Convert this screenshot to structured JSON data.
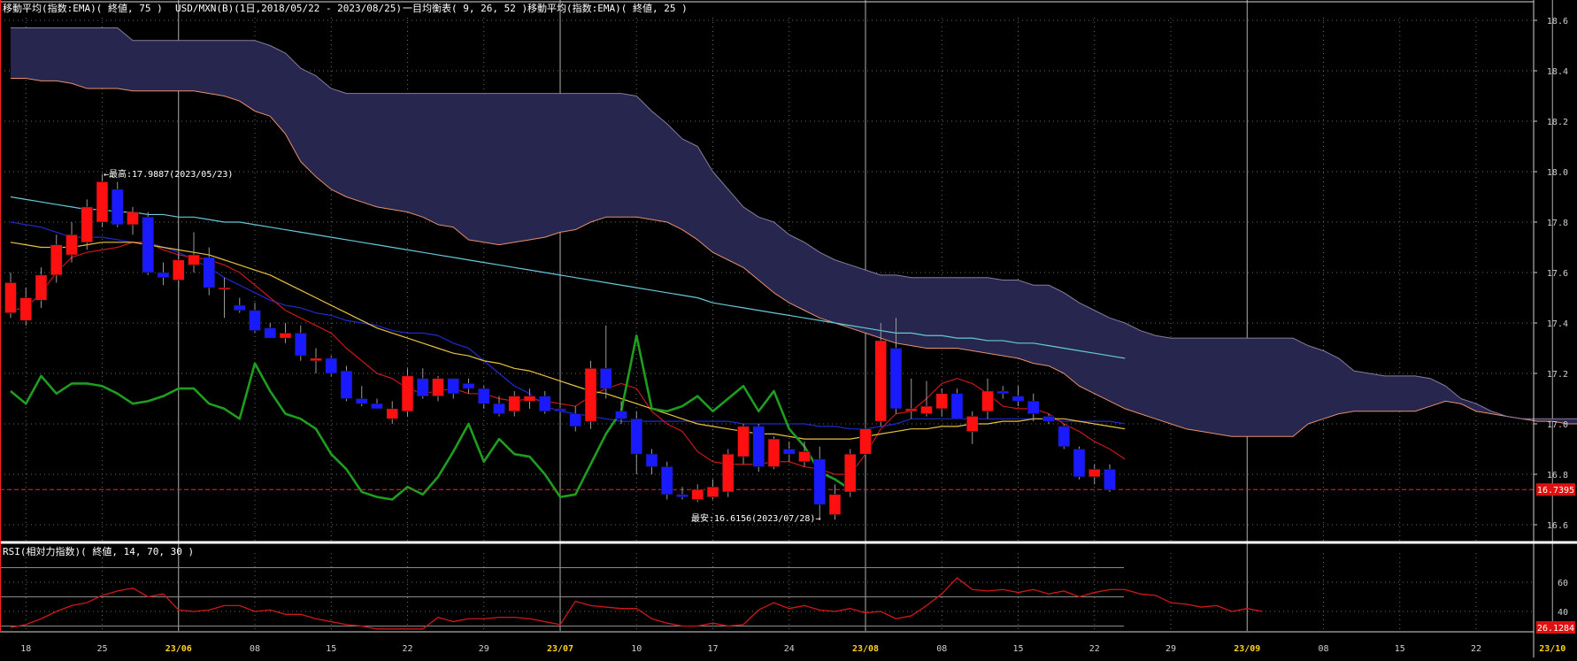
{
  "header": {
    "ema75": "移動平均(指数:EMA)( 終値, 75 )",
    "symbol": "USD/MXN(B)(1日,2018/05/22 - 2023/08/25)",
    "ichimoku": "一目均衡表( 9, 26, 52 )",
    "ema25": "移動平均(指数:EMA)( 終値, 25 )"
  },
  "rsi_header": "RSI(相対力指数)( 終値, 14, 70, 30 )",
  "annotations": {
    "high": "←最高:17.9887(2023/05/23)",
    "low": "最安:16.6156(2023/07/28)→"
  },
  "colors": {
    "up": "#ff1010",
    "down": "#1a1aff",
    "cloud": "#26264e",
    "cloud_edge": "#e6906a",
    "ema75": "#66c8d8",
    "ema25": "#e8c040",
    "tenkan": "#c81818",
    "kijun": "#1e2ad0",
    "chikou": "#1e9e1e",
    "rsi": "#d01818",
    "price_line": "#ff2020"
  },
  "chart_data": [
    {
      "type": "candlestick",
      "series_label": "USD/MXN(B)",
      "y_ticks": [
        16.6,
        16.8,
        17.0,
        17.2,
        17.4,
        17.6,
        17.8,
        18.0,
        18.2,
        18.4,
        18.6
      ],
      "ylim": [
        16.5,
        18.65
      ],
      "x_ticks": [
        "18",
        "25",
        "23/06",
        "08",
        "15",
        "22",
        "29",
        "23/07",
        "10",
        "17",
        "24",
        "23/08",
        "08",
        "15",
        "22",
        "29",
        "23/09",
        "08",
        "15",
        "22",
        "23/10"
      ],
      "x_tick_highlight": [
        "23/06",
        "23/07",
        "23/08",
        "23/09",
        "23/10"
      ],
      "current_price_label": "16.7395",
      "current_price": 16.7395,
      "candles": [
        {
          "o": 17.44,
          "h": 17.6,
          "l": 17.42,
          "c": 17.56
        },
        {
          "o": 17.41,
          "h": 17.54,
          "l": 17.39,
          "c": 17.5
        },
        {
          "o": 17.49,
          "h": 17.62,
          "l": 17.46,
          "c": 17.59
        },
        {
          "o": 17.59,
          "h": 17.75,
          "l": 17.56,
          "c": 17.71
        },
        {
          "o": 17.67,
          "h": 17.8,
          "l": 17.64,
          "c": 17.75
        },
        {
          "o": 17.72,
          "h": 17.89,
          "l": 17.69,
          "c": 17.86
        },
        {
          "o": 17.8,
          "h": 17.99,
          "l": 17.78,
          "c": 17.96
        },
        {
          "o": 17.93,
          "h": 17.96,
          "l": 17.78,
          "c": 17.79
        },
        {
          "o": 17.79,
          "h": 17.86,
          "l": 17.75,
          "c": 17.84
        },
        {
          "o": 17.82,
          "h": 17.84,
          "l": 17.59,
          "c": 17.6
        },
        {
          "o": 17.6,
          "h": 17.64,
          "l": 17.55,
          "c": 17.58
        },
        {
          "o": 17.57,
          "h": 17.68,
          "l": 17.54,
          "c": 17.65
        },
        {
          "o": 17.63,
          "h": 17.76,
          "l": 17.6,
          "c": 17.67
        },
        {
          "o": 17.66,
          "h": 17.7,
          "l": 17.51,
          "c": 17.54
        },
        {
          "o": 17.54,
          "h": 17.58,
          "l": 17.42,
          "c": 17.54
        },
        {
          "o": 17.47,
          "h": 17.5,
          "l": 17.44,
          "c": 17.45
        },
        {
          "o": 17.45,
          "h": 17.48,
          "l": 17.36,
          "c": 17.37
        },
        {
          "o": 17.38,
          "h": 17.4,
          "l": 17.34,
          "c": 17.34
        },
        {
          "o": 17.34,
          "h": 17.4,
          "l": 17.32,
          "c": 17.36
        },
        {
          "o": 17.36,
          "h": 17.39,
          "l": 17.25,
          "c": 17.27
        },
        {
          "o": 17.25,
          "h": 17.3,
          "l": 17.2,
          "c": 17.26
        },
        {
          "o": 17.26,
          "h": 17.27,
          "l": 17.19,
          "c": 17.2
        },
        {
          "o": 17.21,
          "h": 17.23,
          "l": 17.09,
          "c": 17.1
        },
        {
          "o": 17.1,
          "h": 17.15,
          "l": 17.07,
          "c": 17.08
        },
        {
          "o": 17.08,
          "h": 17.1,
          "l": 17.06,
          "c": 17.06
        },
        {
          "o": 17.02,
          "h": 17.09,
          "l": 17.0,
          "c": 17.06
        },
        {
          "o": 17.05,
          "h": 17.22,
          "l": 17.03,
          "c": 17.19
        },
        {
          "o": 17.18,
          "h": 17.22,
          "l": 17.1,
          "c": 17.11
        },
        {
          "o": 17.11,
          "h": 17.19,
          "l": 17.09,
          "c": 17.18
        },
        {
          "o": 17.18,
          "h": 17.18,
          "l": 17.1,
          "c": 17.12
        },
        {
          "o": 17.16,
          "h": 17.18,
          "l": 17.12,
          "c": 17.14
        },
        {
          "o": 17.14,
          "h": 17.15,
          "l": 17.06,
          "c": 17.08
        },
        {
          "o": 17.08,
          "h": 17.11,
          "l": 17.03,
          "c": 17.04
        },
        {
          "o": 17.05,
          "h": 17.13,
          "l": 17.03,
          "c": 17.11
        },
        {
          "o": 17.09,
          "h": 17.14,
          "l": 17.06,
          "c": 17.11
        },
        {
          "o": 17.11,
          "h": 17.13,
          "l": 17.04,
          "c": 17.05
        },
        {
          "o": 17.06,
          "h": 17.09,
          "l": 17.04,
          "c": 17.05
        },
        {
          "o": 17.04,
          "h": 17.07,
          "l": 16.97,
          "c": 16.99
        },
        {
          "o": 17.01,
          "h": 17.25,
          "l": 16.98,
          "c": 17.22
        },
        {
          "o": 17.22,
          "h": 17.39,
          "l": 17.1,
          "c": 17.14
        },
        {
          "o": 17.05,
          "h": 17.09,
          "l": 17.0,
          "c": 17.02
        },
        {
          "o": 17.02,
          "h": 17.05,
          "l": 16.8,
          "c": 16.88
        },
        {
          "o": 16.88,
          "h": 16.9,
          "l": 16.8,
          "c": 16.83
        },
        {
          "o": 16.83,
          "h": 16.85,
          "l": 16.7,
          "c": 16.72
        },
        {
          "o": 16.72,
          "h": 16.75,
          "l": 16.7,
          "c": 16.71
        },
        {
          "o": 16.7,
          "h": 16.76,
          "l": 16.69,
          "c": 16.74
        },
        {
          "o": 16.71,
          "h": 16.78,
          "l": 16.7,
          "c": 16.75
        },
        {
          "o": 16.73,
          "h": 16.9,
          "l": 16.71,
          "c": 16.88
        },
        {
          "o": 16.87,
          "h": 17.0,
          "l": 16.84,
          "c": 16.99
        },
        {
          "o": 16.99,
          "h": 17.0,
          "l": 16.81,
          "c": 16.83
        },
        {
          "o": 16.83,
          "h": 16.95,
          "l": 16.82,
          "c": 16.94
        },
        {
          "o": 16.9,
          "h": 16.93,
          "l": 16.85,
          "c": 16.88
        },
        {
          "o": 16.85,
          "h": 16.93,
          "l": 16.83,
          "c": 16.89
        },
        {
          "o": 16.86,
          "h": 16.91,
          "l": 16.62,
          "c": 16.68
        },
        {
          "o": 16.64,
          "h": 16.76,
          "l": 16.62,
          "c": 16.72
        },
        {
          "o": 16.73,
          "h": 16.9,
          "l": 16.71,
          "c": 16.88
        },
        {
          "o": 16.88,
          "h": 17.0,
          "l": 16.87,
          "c": 16.98
        },
        {
          "o": 17.01,
          "h": 17.4,
          "l": 16.99,
          "c": 17.33
        },
        {
          "o": 17.3,
          "h": 17.42,
          "l": 17.04,
          "c": 17.06
        },
        {
          "o": 17.05,
          "h": 17.18,
          "l": 17.02,
          "c": 17.06
        },
        {
          "o": 17.04,
          "h": 17.17,
          "l": 17.03,
          "c": 17.07
        },
        {
          "o": 17.06,
          "h": 17.14,
          "l": 17.03,
          "c": 17.12
        },
        {
          "o": 17.12,
          "h": 17.14,
          "l": 17.02,
          "c": 17.02
        },
        {
          "o": 16.97,
          "h": 17.05,
          "l": 16.92,
          "c": 17.03
        },
        {
          "o": 17.05,
          "h": 17.18,
          "l": 17.02,
          "c": 17.13
        },
        {
          "o": 17.13,
          "h": 17.15,
          "l": 17.1,
          "c": 17.12
        },
        {
          "o": 17.11,
          "h": 17.15,
          "l": 17.07,
          "c": 17.09
        },
        {
          "o": 17.09,
          "h": 17.12,
          "l": 17.01,
          "c": 17.04
        },
        {
          "o": 17.03,
          "h": 17.04,
          "l": 17.0,
          "c": 17.01
        },
        {
          "o": 16.99,
          "h": 17.0,
          "l": 16.9,
          "c": 16.91
        },
        {
          "o": 16.9,
          "h": 16.91,
          "l": 16.78,
          "c": 16.79
        },
        {
          "o": 16.79,
          "h": 16.84,
          "l": 16.76,
          "c": 16.82
        },
        {
          "o": 16.82,
          "h": 16.84,
          "l": 16.73,
          "c": 16.74
        }
      ],
      "ema75": [
        17.9,
        17.89,
        17.88,
        17.87,
        17.86,
        17.85,
        17.85,
        17.84,
        17.84,
        17.83,
        17.83,
        17.82,
        17.82,
        17.81,
        17.8,
        17.8,
        17.79,
        17.78,
        17.77,
        17.76,
        17.75,
        17.74,
        17.73,
        17.72,
        17.71,
        17.7,
        17.69,
        17.68,
        17.67,
        17.66,
        17.65,
        17.64,
        17.63,
        17.62,
        17.61,
        17.6,
        17.59,
        17.58,
        17.57,
        17.56,
        17.55,
        17.54,
        17.53,
        17.52,
        17.51,
        17.5,
        17.48,
        17.47,
        17.46,
        17.45,
        17.44,
        17.43,
        17.42,
        17.41,
        17.4,
        17.39,
        17.38,
        17.37,
        17.36,
        17.36,
        17.35,
        17.35,
        17.34,
        17.34,
        17.33,
        17.33,
        17.32,
        17.32,
        17.31,
        17.3,
        17.29,
        17.28,
        17.27,
        17.26
      ],
      "ema25": [
        17.72,
        17.71,
        17.7,
        17.7,
        17.7,
        17.71,
        17.72,
        17.72,
        17.72,
        17.71,
        17.7,
        17.69,
        17.68,
        17.67,
        17.65,
        17.63,
        17.61,
        17.59,
        17.56,
        17.53,
        17.5,
        17.47,
        17.44,
        17.41,
        17.38,
        17.36,
        17.34,
        17.32,
        17.3,
        17.28,
        17.27,
        17.25,
        17.24,
        17.22,
        17.21,
        17.19,
        17.17,
        17.15,
        17.13,
        17.12,
        17.1,
        17.08,
        17.06,
        17.04,
        17.02,
        17.0,
        16.99,
        16.98,
        16.97,
        16.96,
        16.96,
        16.95,
        16.94,
        16.94,
        16.94,
        16.94,
        16.95,
        16.96,
        16.97,
        16.98,
        16.98,
        16.99,
        16.99,
        17.0,
        17.0,
        17.01,
        17.01,
        17.02,
        17.02,
        17.02,
        17.01,
        17.0,
        16.99,
        16.98
      ],
      "tenkan": [
        17.45,
        17.46,
        17.52,
        17.6,
        17.66,
        17.68,
        17.69,
        17.7,
        17.72,
        17.72,
        17.69,
        17.67,
        17.66,
        17.65,
        17.63,
        17.6,
        17.55,
        17.5,
        17.45,
        17.42,
        17.39,
        17.36,
        17.3,
        17.25,
        17.2,
        17.18,
        17.14,
        17.12,
        17.13,
        17.14,
        17.12,
        17.12,
        17.1,
        17.09,
        17.1,
        17.09,
        17.08,
        17.07,
        17.11,
        17.14,
        17.16,
        17.14,
        17.05,
        17.0,
        16.97,
        16.89,
        16.85,
        16.84,
        16.84,
        16.84,
        16.85,
        16.85,
        16.83,
        16.82,
        16.8,
        16.8,
        16.88,
        16.98,
        17.04,
        17.05,
        17.1,
        17.16,
        17.18,
        17.16,
        17.12,
        17.07,
        17.06,
        17.06,
        17.04,
        17.0,
        16.97,
        16.93,
        16.9,
        16.86
      ],
      "kijun": [
        17.8,
        17.79,
        17.78,
        17.76,
        17.74,
        17.74,
        17.74,
        17.73,
        17.72,
        17.72,
        17.7,
        17.68,
        17.65,
        17.62,
        17.58,
        17.55,
        17.52,
        17.49,
        17.47,
        17.46,
        17.44,
        17.43,
        17.41,
        17.4,
        17.39,
        17.37,
        17.36,
        17.36,
        17.35,
        17.32,
        17.3,
        17.25,
        17.2,
        17.15,
        17.12,
        17.07,
        17.05,
        17.04,
        17.03,
        17.02,
        17.01,
        17.01,
        17.01,
        17.01,
        17.01,
        17.01,
        17.01,
        17.01,
        17.0,
        17.0,
        17.0,
        17.0,
        17.0,
        16.99,
        16.99,
        16.98,
        16.98,
        16.99,
        17.0,
        17.02,
        17.02,
        17.02,
        17.02,
        17.02,
        17.02,
        17.02,
        17.02,
        17.02,
        17.02,
        17.01,
        17.01,
        17.01,
        17.01,
        17.0
      ],
      "chikou": [
        17.13,
        17.08,
        17.19,
        17.12,
        17.16,
        17.16,
        17.15,
        17.12,
        17.08,
        17.09,
        17.11,
        17.14,
        17.14,
        17.08,
        17.06,
        17.02,
        17.24,
        17.13,
        17.04,
        17.02,
        16.98,
        16.88,
        16.82,
        16.73,
        16.71,
        16.7,
        16.75,
        16.72,
        16.79,
        16.89,
        17.0,
        16.85,
        16.94,
        16.88,
        16.87,
        16.8,
        16.71,
        16.72,
        16.84,
        16.96,
        17.05,
        17.35,
        17.06,
        17.05,
        17.07,
        17.11,
        17.05,
        17.1,
        17.15,
        17.05,
        17.13,
        16.98,
        16.91,
        16.81,
        16.78,
        16.74
      ],
      "span_a": [
        18.37,
        18.37,
        18.36,
        18.36,
        18.35,
        18.33,
        18.33,
        18.33,
        18.32,
        18.32,
        18.32,
        18.32,
        18.32,
        18.31,
        18.3,
        18.28,
        18.24,
        18.22,
        18.15,
        18.04,
        17.98,
        17.93,
        17.9,
        17.88,
        17.86,
        17.85,
        17.84,
        17.82,
        17.79,
        17.78,
        17.73,
        17.72,
        17.71,
        17.72,
        17.73,
        17.74,
        17.76,
        17.77,
        17.8,
        17.82,
        17.82,
        17.82,
        17.81,
        17.8,
        17.77,
        17.73,
        17.68,
        17.65,
        17.62,
        17.57,
        17.52,
        17.48,
        17.45,
        17.42,
        17.4,
        17.38,
        17.36,
        17.34,
        17.32,
        17.31,
        17.3,
        17.3,
        17.3,
        17.29,
        17.28,
        17.27,
        17.26,
        17.24,
        17.23,
        17.2,
        17.15,
        17.12,
        17.09,
        17.06,
        17.04,
        17.02,
        17.0,
        16.98,
        16.97,
        16.96,
        16.95,
        16.95,
        16.95,
        16.95,
        16.95,
        17.0,
        17.02,
        17.04,
        17.05,
        17.05,
        17.05,
        17.05,
        17.05,
        17.07,
        17.09,
        17.08,
        17.05,
        17.04,
        17.03,
        17.02,
        17.01,
        17.01,
        17.0,
        17.0
      ],
      "span_b": [
        18.57,
        18.57,
        18.57,
        18.57,
        18.57,
        18.57,
        18.57,
        18.57,
        18.52,
        18.52,
        18.52,
        18.52,
        18.52,
        18.52,
        18.52,
        18.52,
        18.52,
        18.5,
        18.47,
        18.41,
        18.38,
        18.33,
        18.31,
        18.31,
        18.31,
        18.31,
        18.31,
        18.31,
        18.31,
        18.31,
        18.31,
        18.31,
        18.31,
        18.31,
        18.31,
        18.31,
        18.31,
        18.31,
        18.31,
        18.31,
        18.31,
        18.3,
        18.24,
        18.19,
        18.13,
        18.1,
        18.0,
        17.93,
        17.86,
        17.82,
        17.8,
        17.75,
        17.72,
        17.68,
        17.65,
        17.63,
        17.61,
        17.59,
        17.59,
        17.58,
        17.58,
        17.58,
        17.58,
        17.58,
        17.58,
        17.57,
        17.57,
        17.55,
        17.55,
        17.52,
        17.48,
        17.45,
        17.42,
        17.4,
        17.37,
        17.35,
        17.34,
        17.34,
        17.34,
        17.34,
        17.34,
        17.34,
        17.34,
        17.34,
        17.34,
        17.31,
        17.29,
        17.26,
        17.21,
        17.2,
        17.19,
        17.19,
        17.19,
        17.18,
        17.15,
        17.1,
        17.08,
        17.05,
        17.03,
        17.02,
        17.02,
        17.02,
        17.02,
        17.02
      ]
    },
    {
      "type": "line",
      "series_label": "RSI",
      "y_ticks": [
        40,
        60
      ],
      "ylim": [
        24,
        72
      ],
      "ref_levels": [
        70,
        50,
        30
      ],
      "current_value_label": "26.1284",
      "values": [
        29,
        31,
        35,
        40,
        44,
        46,
        51,
        54,
        56,
        50,
        52,
        41,
        40,
        41,
        44,
        44,
        40,
        41,
        38,
        38,
        35,
        33,
        31,
        30,
        28,
        28,
        28,
        28,
        36,
        33,
        35,
        35,
        36,
        36,
        35,
        33,
        31,
        47,
        44,
        43,
        42,
        42,
        35,
        32,
        30,
        30,
        32,
        30,
        31,
        41,
        46,
        42,
        44,
        41,
        40,
        42,
        39,
        40,
        35,
        37,
        44,
        52,
        63,
        55,
        54,
        55,
        53,
        55,
        52,
        54,
        50,
        53,
        55,
        55,
        52,
        51,
        46,
        45,
        43,
        44,
        40,
        42,
        40
      ]
    }
  ]
}
